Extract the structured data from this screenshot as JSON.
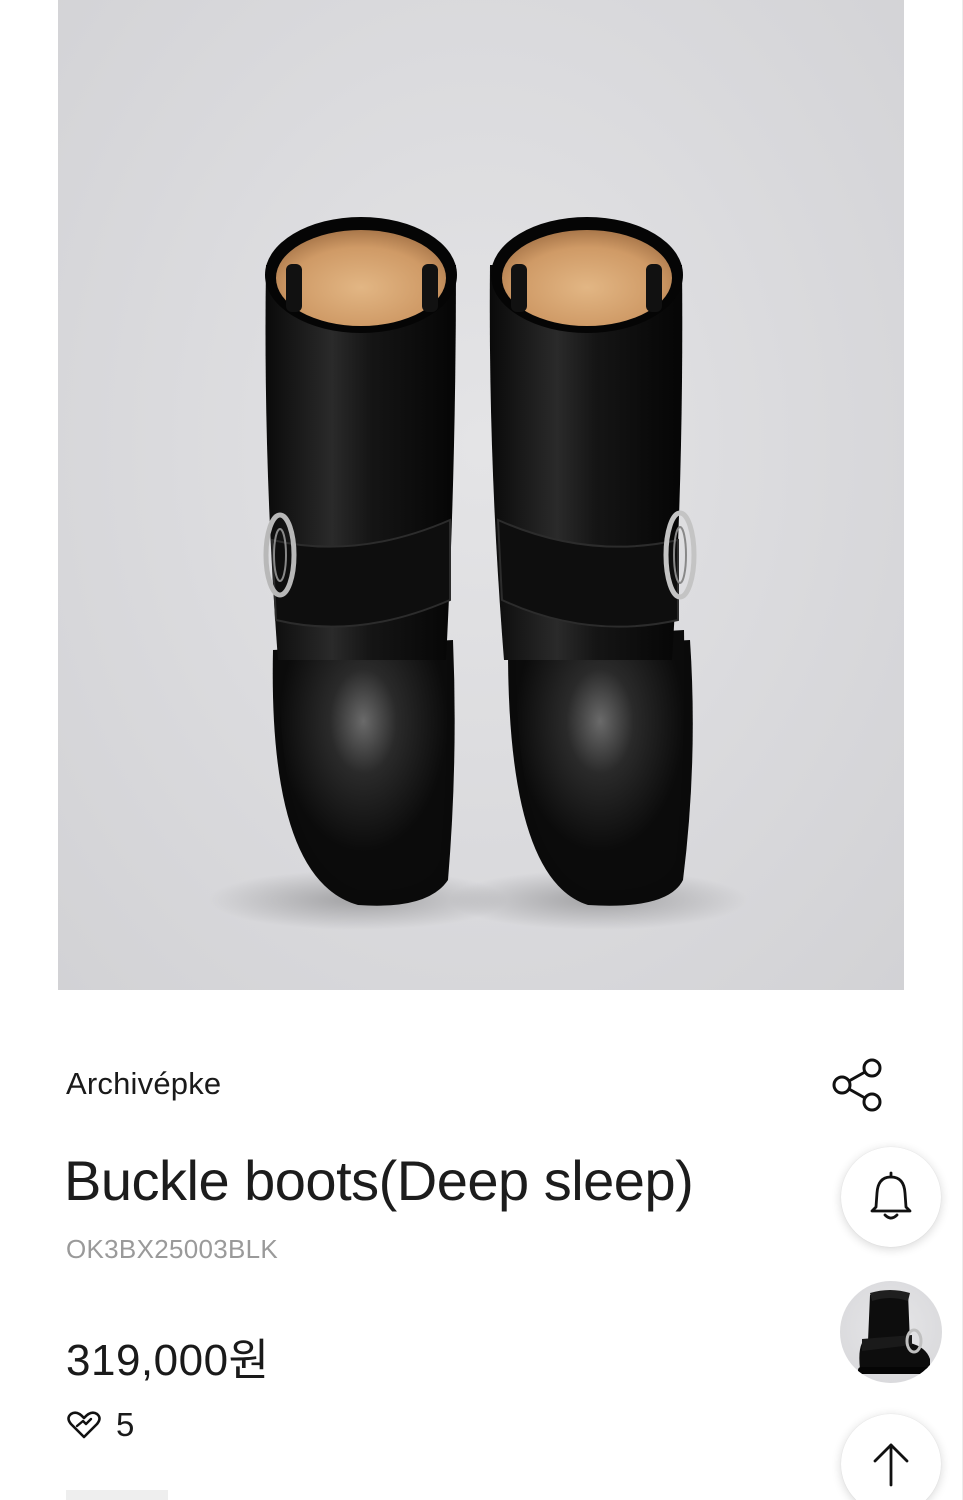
{
  "product": {
    "image_alt": "Buckle boots black leather",
    "brand": "Archivépke",
    "title": "Buckle boots(Deep sleep)",
    "sku": "OK3BX25003BLK",
    "price": "319,000원",
    "likes": "5"
  },
  "actions": {
    "share_icon": "share-icon",
    "bell_icon": "bell-icon",
    "thumbnail": "recent-product-thumbnail",
    "top_icon": "arrow-up-icon",
    "like_icon": "heart-icon"
  },
  "colors": {
    "background": "#ffffff",
    "image_background": "#dcdcdf",
    "text": "#1a1a1a",
    "muted_text": "#9a9a9a"
  }
}
